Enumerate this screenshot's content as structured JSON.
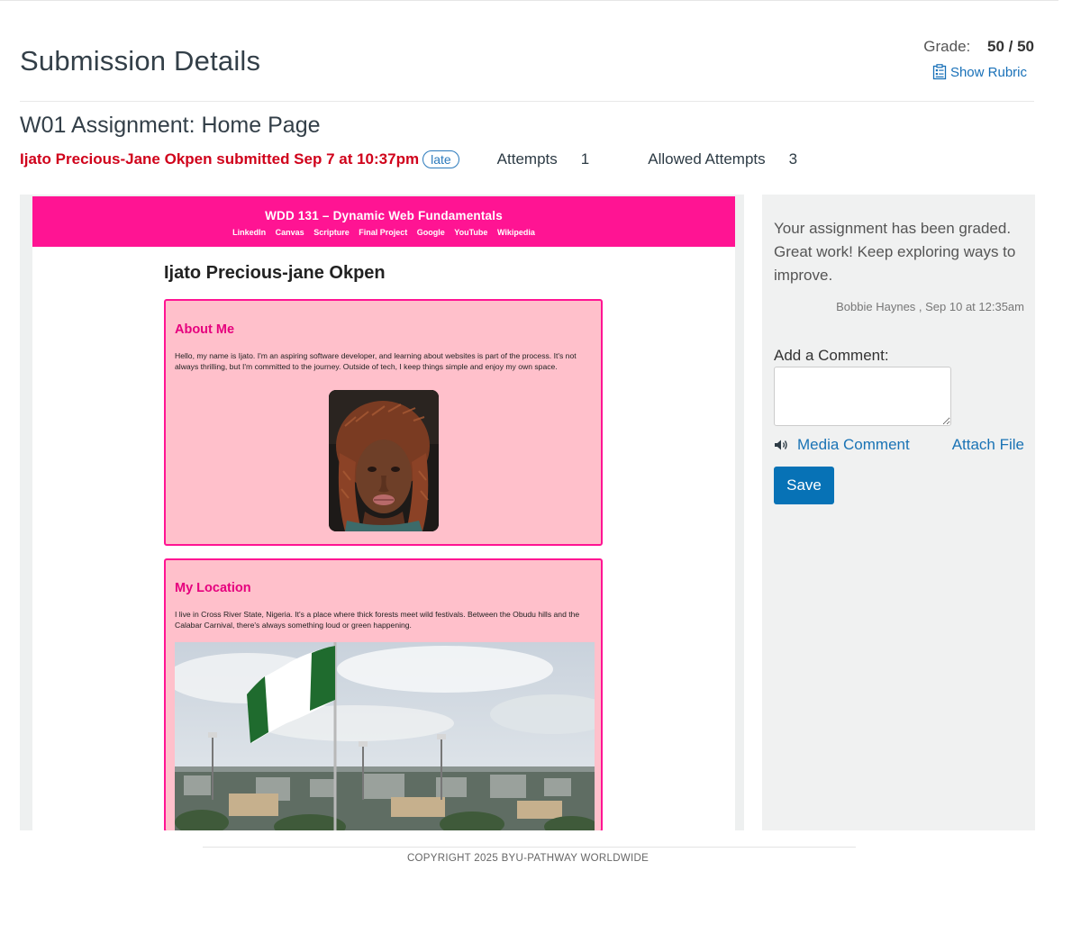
{
  "header": {
    "title": "Submission Details",
    "grade_label": "Grade:",
    "grade_value": "50 / 50",
    "rubric_link": "Show Rubric"
  },
  "assignment": {
    "title": "W01 Assignment: Home Page",
    "submitter_text": "Ijato Precious-Jane Okpen submitted Sep 7 at 10:37pm",
    "late_badge": "late",
    "attempts_label": "Attempts",
    "attempts_value": "1",
    "allowed_attempts_label": "Allowed Attempts",
    "allowed_attempts_value": "3"
  },
  "preview": {
    "site_title": "WDD 131 – Dynamic Web Fundamentals",
    "nav_links": [
      "LinkedIn",
      "Canvas",
      "Scripture",
      "Final Project",
      "Google",
      "YouTube",
      "Wikipedia"
    ],
    "site_name": "Ijato Precious-jane Okpen",
    "about_heading": "About Me",
    "about_text": "Hello, my name is Ijato. I'm an aspiring software developer, and learning about websites is part of the process. It's not always thrilling, but I'm committed to the journey. Outside of tech, I keep things simple and enjoy my own space.",
    "location_heading": "My Location",
    "location_text": "I live in Cross River State, Nigeria. It's a place where thick forests meet wild festivals. Between the Obudu hills and the Calabar Carnival, there's always something loud or green happening.",
    "colors": {
      "header_bg": "#ff1493",
      "card_bg": "#ffc0cb",
      "card_border": "#ff1493"
    }
  },
  "comments": {
    "grader_comment": "Your assignment has been graded. Great work! Keep exploring ways to improve.",
    "comment_meta": "Bobbie Haynes , Sep 10 at 12:35am",
    "add_comment_label": "Add a Comment:",
    "comment_value": "",
    "media_comment_label": "Media Comment",
    "attach_file_label": "Attach File",
    "save_label": "Save"
  },
  "footer": {
    "copyright": "COPYRIGHT 2025 BYU-PATHWAY WORLDWIDE"
  },
  "colors": {
    "accent_link": "#1870b8",
    "submitter": "#d0021b",
    "save_button": "#0772b6"
  }
}
